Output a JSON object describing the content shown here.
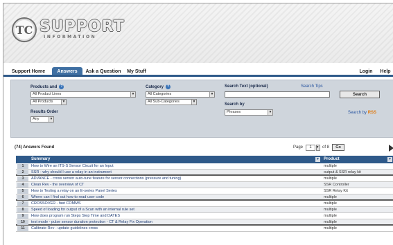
{
  "brand": {
    "logo_mark": "TC",
    "title": "SUPPORT",
    "subtitle": "INFORMATION"
  },
  "nav": {
    "tabs": [
      {
        "label": "Support Home",
        "active": false
      },
      {
        "label": "Answers",
        "active": true
      },
      {
        "label": "Ask a Question",
        "active": false
      },
      {
        "label": "My Stuff",
        "active": false
      }
    ],
    "right": [
      "Login",
      "Help"
    ]
  },
  "search": {
    "products_label": "Products and",
    "category_label": "Category",
    "search_text_label": "Search Text (optional)",
    "search_tips_link": "Search Tips",
    "search_by_label": "Search by",
    "sort_by_label": "Results Order",
    "product_select_1": "All Product Lines",
    "product_select_2": "All Products",
    "category_select_1": "All Categories",
    "category_select_2": "All Sub-Categories",
    "search_by_value": "Phrases",
    "sort_value": "Any",
    "search_button": "Search",
    "rss_link_text": "Search by",
    "rss_badge": "RSS"
  },
  "results": {
    "count_text": "(74) Answers Found",
    "page_label": "Page",
    "page_value": "1",
    "page_of": "of 8",
    "go_button": "Go"
  },
  "table": {
    "col_summary": "Summary",
    "col_product": "Product",
    "rows": [
      {
        "n": "1",
        "title": "How to Wire an ITS-S Sensor Circuit for an Input",
        "product": "multiple"
      },
      {
        "n": "2",
        "title": "SSR - why should I use a relay in an instrument",
        "product": "output & SSR relay kit"
      },
      {
        "n": "3",
        "title": "ADVANCE - cross sensor auto-tune feature for sensor connections (pressure and tuning)",
        "product": "multiple"
      },
      {
        "n": "4",
        "title": "Clean Rev - the overview of CT",
        "product": "SSR Controller"
      },
      {
        "n": "5",
        "title": "How to Testing a relay on an E-series Panel Series",
        "product": "SSR Relay Kit"
      },
      {
        "n": "6",
        "title": "Where can I find out how to read user code",
        "product": "multiple"
      },
      {
        "n": "7",
        "title": "CROSSOVER - fast COMMS",
        "product": "multiple"
      },
      {
        "n": "8",
        "title": "Speed of loading for output of a Scan with an internal rule set",
        "product": "multiple"
      },
      {
        "n": "9",
        "title": "How does program run Steps Step Time and DATES",
        "product": "multiple"
      },
      {
        "n": "10",
        "title": "test mode - pulse sensor duration protection - CT & Relay Fix Operation",
        "product": "multiple"
      },
      {
        "n": "11",
        "title": "Calibrate Rev - update guidelines cross",
        "product": "multiple"
      }
    ]
  }
}
